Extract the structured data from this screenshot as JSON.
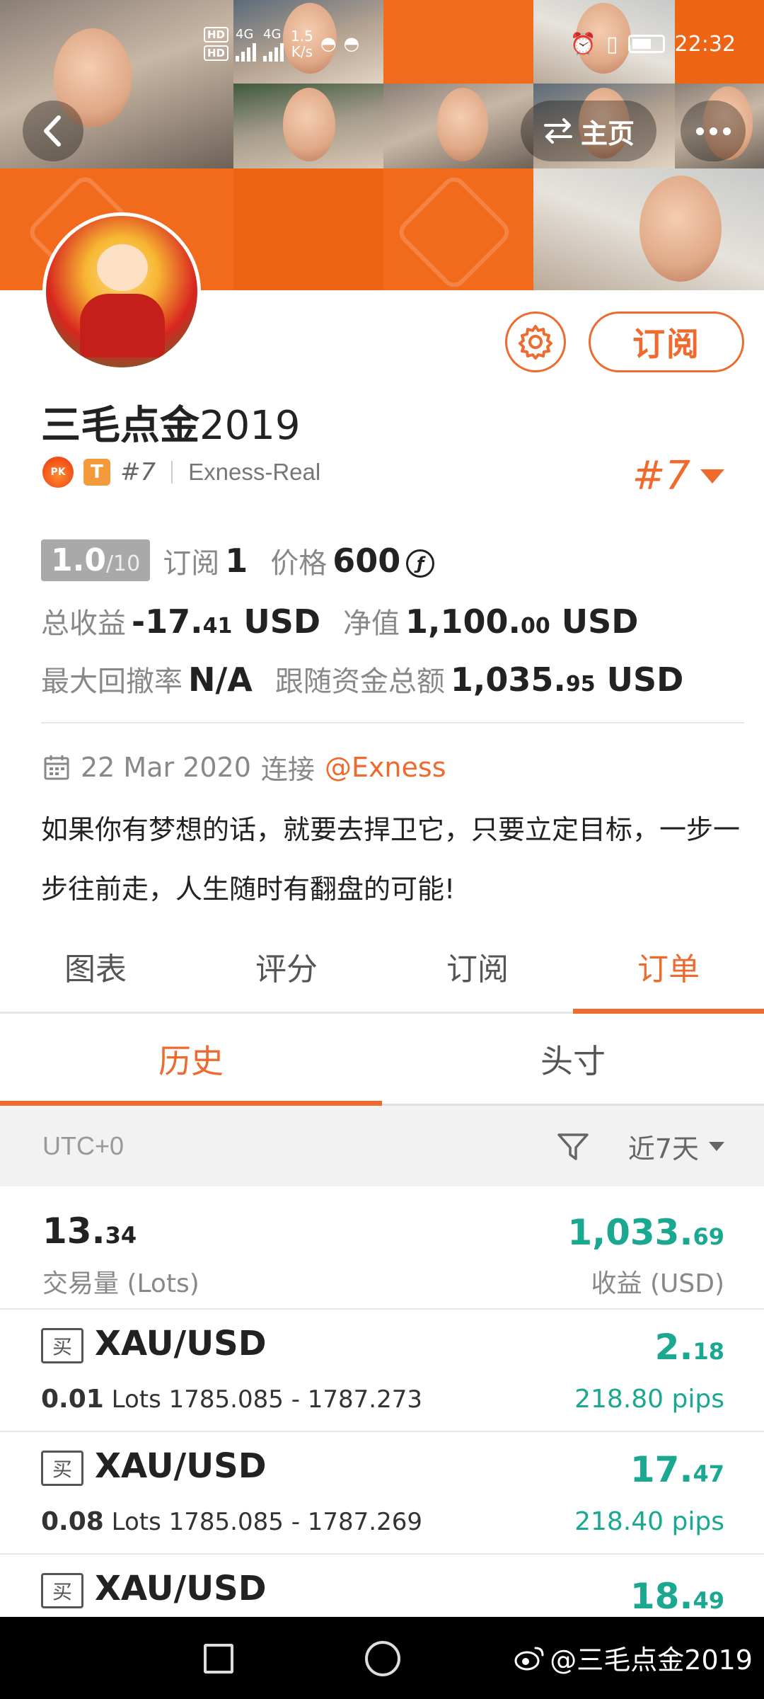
{
  "status_bar": {
    "network_badges": [
      "HD",
      "HD"
    ],
    "net_labels": [
      "4G",
      "4G"
    ],
    "speed": "1.5",
    "speed_unit": "K/s",
    "time": "22:32"
  },
  "header": {
    "home_label": "主页",
    "home_icon": "swap-arrows-icon",
    "back_icon": "chevron-left-icon",
    "more_icon": "ellipsis-icon"
  },
  "profile": {
    "name_cjk": "三毛点金",
    "name_year": "2019",
    "subscribe_label": "订阅",
    "settings_icon": "gear-icon",
    "pk_label": "PK",
    "tier_badge": "T",
    "rank_small": "#7",
    "broker": "Exness-Real",
    "rank_big": "#7"
  },
  "stats": {
    "score": "1.0",
    "score_den": "/10",
    "subscribe_label": "订阅",
    "subscribe_count": "1",
    "price_label": "价格",
    "price_value": "600",
    "price_icon": "ƒ",
    "total_profit_label": "总收益",
    "total_profit_int": "-17.",
    "total_profit_dec": "41",
    "total_profit_unit": "USD",
    "equity_label": "净值",
    "equity_int": "1,100.",
    "equity_dec": "00",
    "equity_unit": "USD",
    "drawdown_label": "最大回撤率",
    "drawdown_value": "N/A",
    "follow_label": "跟随资金总额",
    "follow_int": "1,035.",
    "follow_dec": "95",
    "follow_unit": "USD"
  },
  "connection": {
    "date": "22 Mar 2020",
    "connect_label": "连接",
    "broker_link": "@Exness"
  },
  "bio": "如果你有梦想的话，就要去捍卫它，只要立定目标，一步一步往前走，人生随时有翻盘的可能!",
  "tabs": [
    {
      "label": "图表",
      "active": false
    },
    {
      "label": "评分",
      "active": false
    },
    {
      "label": "订阅",
      "active": false
    },
    {
      "label": "订单",
      "active": true
    }
  ],
  "subtabs": [
    {
      "label": "历史",
      "active": true
    },
    {
      "label": "头寸",
      "active": false
    }
  ],
  "filter": {
    "timezone": "UTC+0",
    "period": "近7天"
  },
  "summary": {
    "lots_int": "13.",
    "lots_dec": "34",
    "lots_label": "交易量 (Lots)",
    "profit_int": "1,033.",
    "profit_dec": "69",
    "profit_label": "收益 (USD)"
  },
  "orders": [
    {
      "side": "买",
      "symbol": "XAU/USD",
      "lots": "0.01",
      "lots_unit": "Lots",
      "range": "1785.085 - 1787.273",
      "pl_int": "2.",
      "pl_dec": "18",
      "pips": "218.80 pips"
    },
    {
      "side": "买",
      "symbol": "XAU/USD",
      "lots": "0.08",
      "lots_unit": "Lots",
      "range": "1785.085 - 1787.269",
      "pl_int": "17.",
      "pl_dec": "47",
      "pips": "218.40 pips"
    },
    {
      "side": "买",
      "symbol": "XAU/USD",
      "pl_int": "18.",
      "pl_dec": "49"
    }
  ],
  "watermark": "@三毛点金2019",
  "colors": {
    "accent": "#ef6a2e",
    "profit": "#1ba890",
    "banner": "#f26a1b"
  }
}
